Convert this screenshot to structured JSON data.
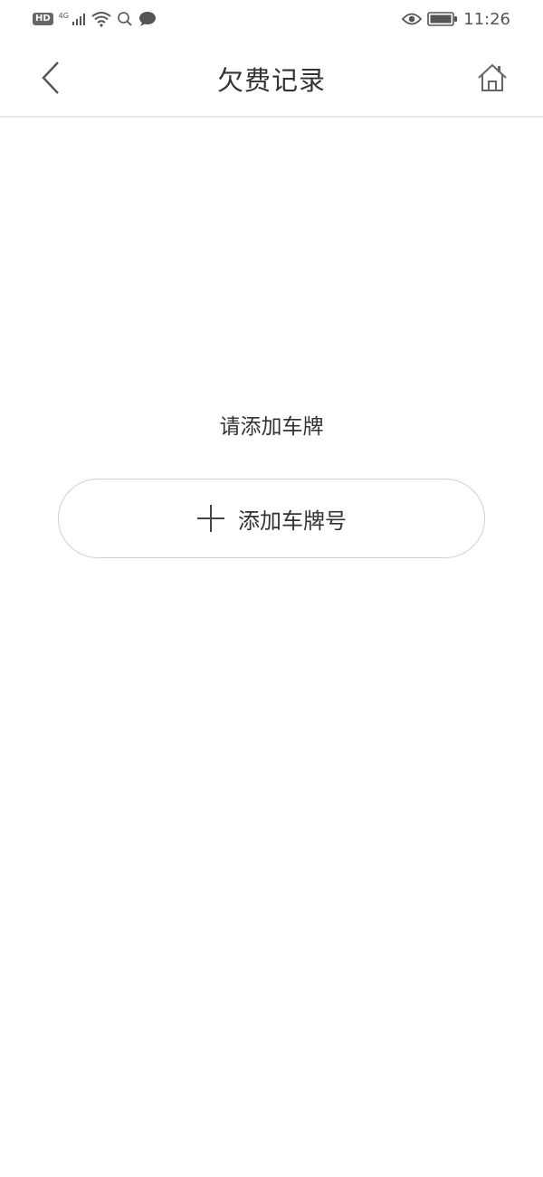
{
  "status_bar": {
    "hd": "HD",
    "network": "4G",
    "time": "11:26",
    "icons": [
      "hd-icon",
      "signal-icon",
      "wifi-icon",
      "search-icon",
      "message-icon",
      "eye-icon",
      "battery-icon"
    ]
  },
  "nav": {
    "title": "欠费记录",
    "back_icon": "chevron-left-icon",
    "home_icon": "home-icon"
  },
  "main": {
    "empty_message": "请添加车牌",
    "add_button_label": "添加车牌号",
    "add_icon": "plus-icon"
  },
  "colors": {
    "text": "#333333",
    "divider": "#e8e8e8",
    "button_border": "#cfcfcf",
    "background": "#ffffff"
  }
}
